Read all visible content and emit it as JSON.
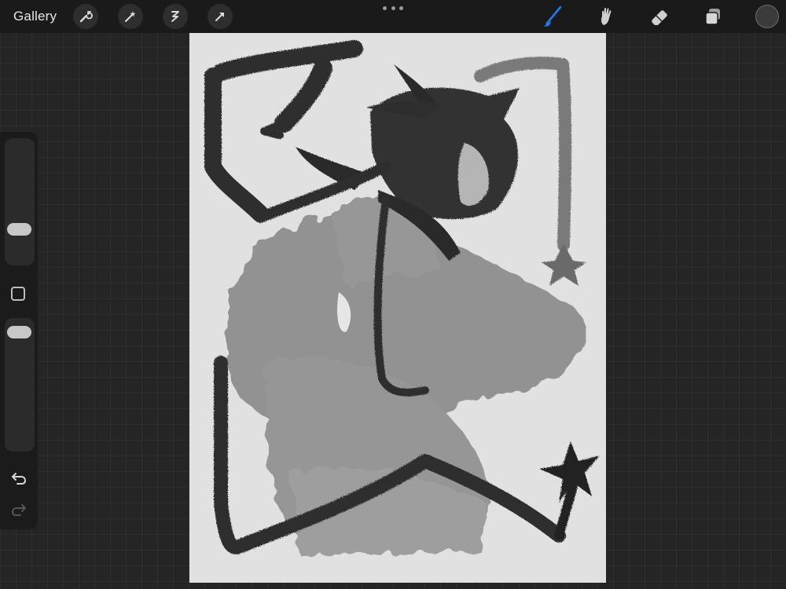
{
  "topbar": {
    "gallery_label": "Gallery",
    "left_tools": [
      "wrench-icon",
      "magic-wand-icon",
      "selection-icon",
      "transform-arrow-icon"
    ],
    "right_tools": [
      "brush-icon",
      "smudge-icon",
      "eraser-icon",
      "layers-icon"
    ],
    "active_tool": "brush-icon",
    "active_color": "#1e7bf2",
    "current_color": "#3b3b3b"
  },
  "sidebar": {
    "brush_size_slider": "slider",
    "modify_button": "square-icon",
    "opacity_slider": "slider",
    "undo": "undo-icon",
    "redo": "redo-icon"
  },
  "canvas": {
    "subject": "sketch",
    "background": "#e1e1e1",
    "ink": "#2a2a2a",
    "fill": "#8a8a8a"
  }
}
